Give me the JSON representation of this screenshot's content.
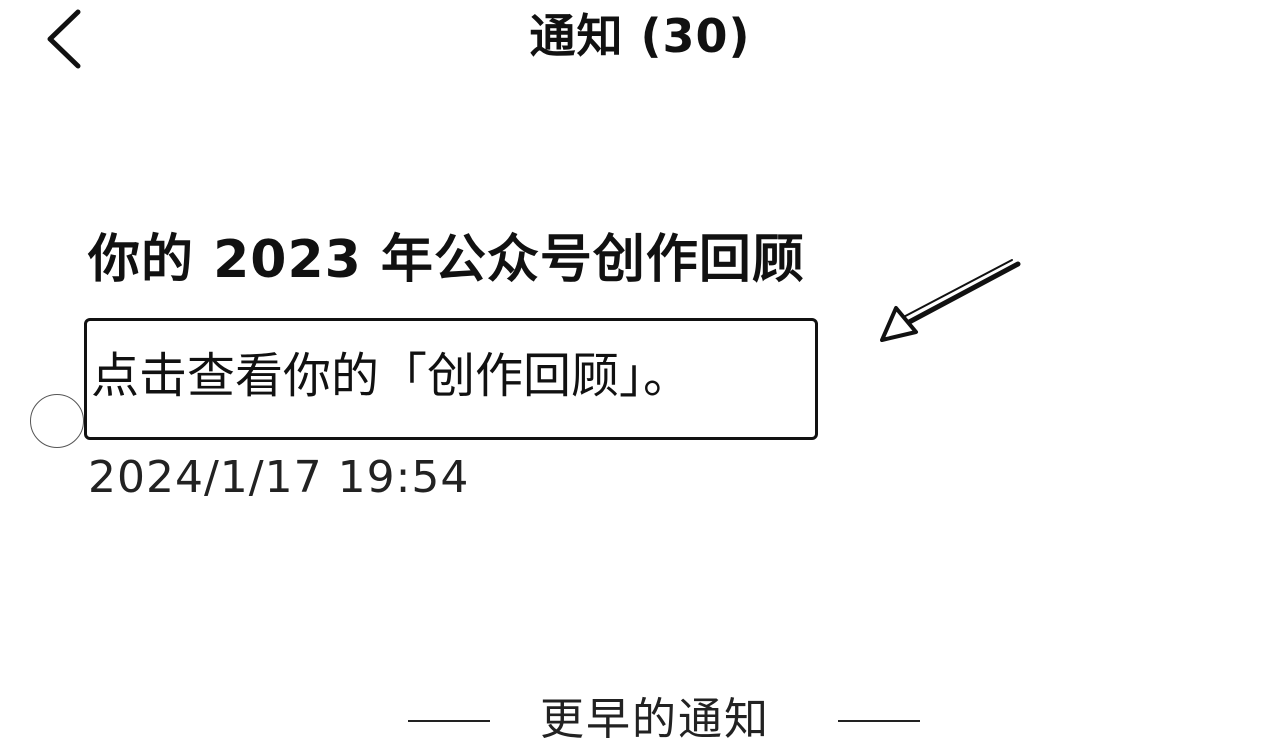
{
  "header": {
    "back_icon": "chevron-left-icon",
    "title": "通知 (30)"
  },
  "notice": {
    "title": "你的 2023 年公众号创作回顾",
    "body": "点击查看你的「创作回顾」。",
    "time": "2024/1/17  19:54"
  },
  "footer": {
    "more_label": "更早的通知"
  },
  "annotations": {
    "arrow_icon": "arrow-annotation-icon",
    "circle_icon": "circle-marker-icon"
  }
}
